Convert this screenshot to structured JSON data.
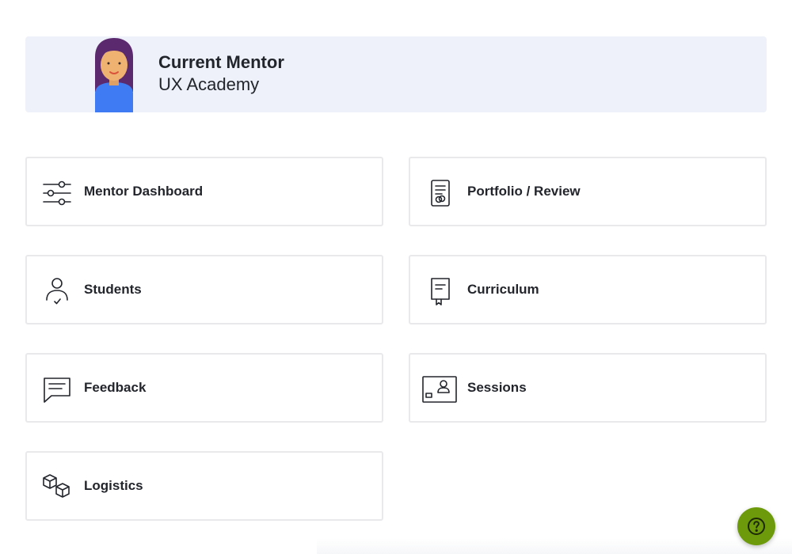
{
  "header": {
    "title": "Current Mentor",
    "subtitle": "UX Academy",
    "avatar": "mentor-avatar-illustration"
  },
  "menu": [
    {
      "label": "Mentor Dashboard",
      "icon": "sliders-icon"
    },
    {
      "label": "Portfolio / Review",
      "icon": "document-review-icon"
    },
    {
      "label": "Students",
      "icon": "user-check-icon"
    },
    {
      "label": "Curriculum",
      "icon": "bookmark-doc-icon"
    },
    {
      "label": "Feedback",
      "icon": "chat-bubble-icon"
    },
    {
      "label": "Sessions",
      "icon": "video-session-icon"
    },
    {
      "label": "Logistics",
      "icon": "cubes-icon"
    }
  ],
  "help": {
    "icon": "question-icon"
  },
  "colors": {
    "header_bg": "#eef1f9",
    "card_border": "#e9e9ec",
    "help_button": "#6c9a0b",
    "text": "#23252c"
  }
}
